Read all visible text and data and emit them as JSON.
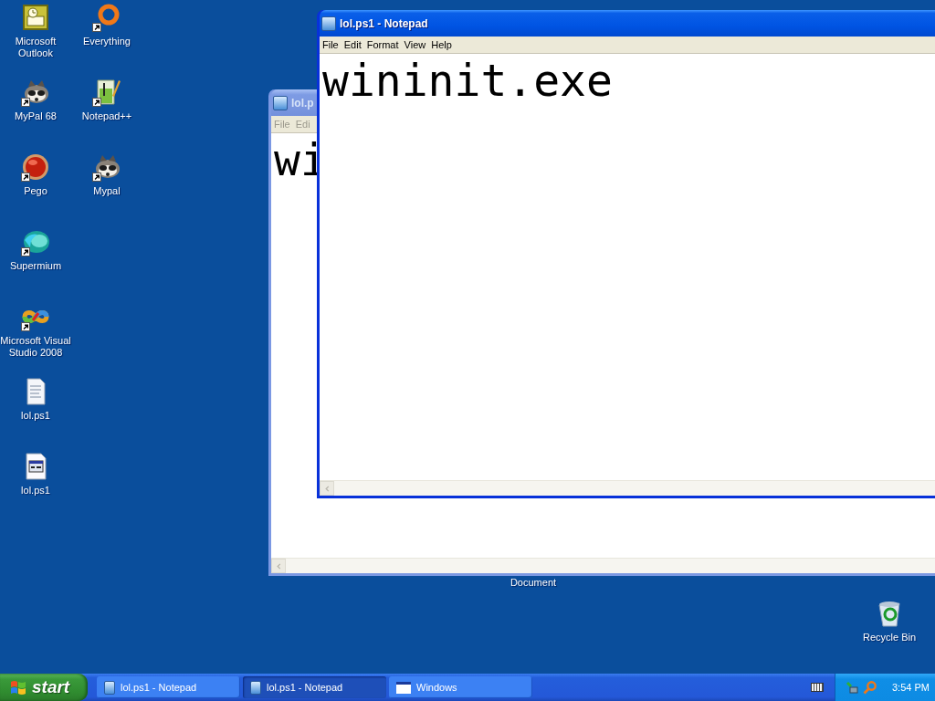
{
  "desktop_icons": [
    {
      "label": "Microsoft Outlook",
      "kind": "outlook",
      "shortcut": false
    },
    {
      "label": "MyPal 68",
      "kind": "raccoon",
      "shortcut": true
    },
    {
      "label": "Pego",
      "kind": "redball",
      "shortcut": true
    },
    {
      "label": "Supermium",
      "kind": "sphere",
      "shortcut": true
    },
    {
      "label": "Microsoft Visual Studio 2008",
      "kind": "infinity",
      "shortcut": true
    },
    {
      "label": "lol.ps1",
      "kind": "textfile",
      "shortcut": false
    },
    {
      "label": "lol.ps1",
      "kind": "scriptfile",
      "shortcut": false
    },
    {
      "label": "Everything",
      "kind": "ring",
      "shortcut": true
    },
    {
      "label": "Notepad++",
      "kind": "notebook",
      "shortcut": true
    },
    {
      "label": "Mypal",
      "kind": "raccoon",
      "shortcut": true
    }
  ],
  "covered_icon": {
    "label": "Document"
  },
  "recycle_bin": {
    "label": "Recycle Bin"
  },
  "windows": [
    {
      "title": "lol.p",
      "menu": [
        "File",
        "Edi"
      ],
      "text": "wi",
      "active": false
    },
    {
      "title": "lol.ps1 - Notepad",
      "menu": [
        "File",
        "Edit",
        "Format",
        "View",
        "Help"
      ],
      "text": "wininit.exe",
      "active": true
    }
  ],
  "taskbar": {
    "start": "start",
    "tasks": [
      {
        "label": "lol.ps1 - Notepad",
        "kind": "notepad",
        "selected": false
      },
      {
        "label": "lol.ps1 - Notepad",
        "kind": "notepad",
        "selected": true
      },
      {
        "label": "Windows",
        "kind": "window",
        "selected": false
      }
    ],
    "clock": "3:54 PM"
  }
}
